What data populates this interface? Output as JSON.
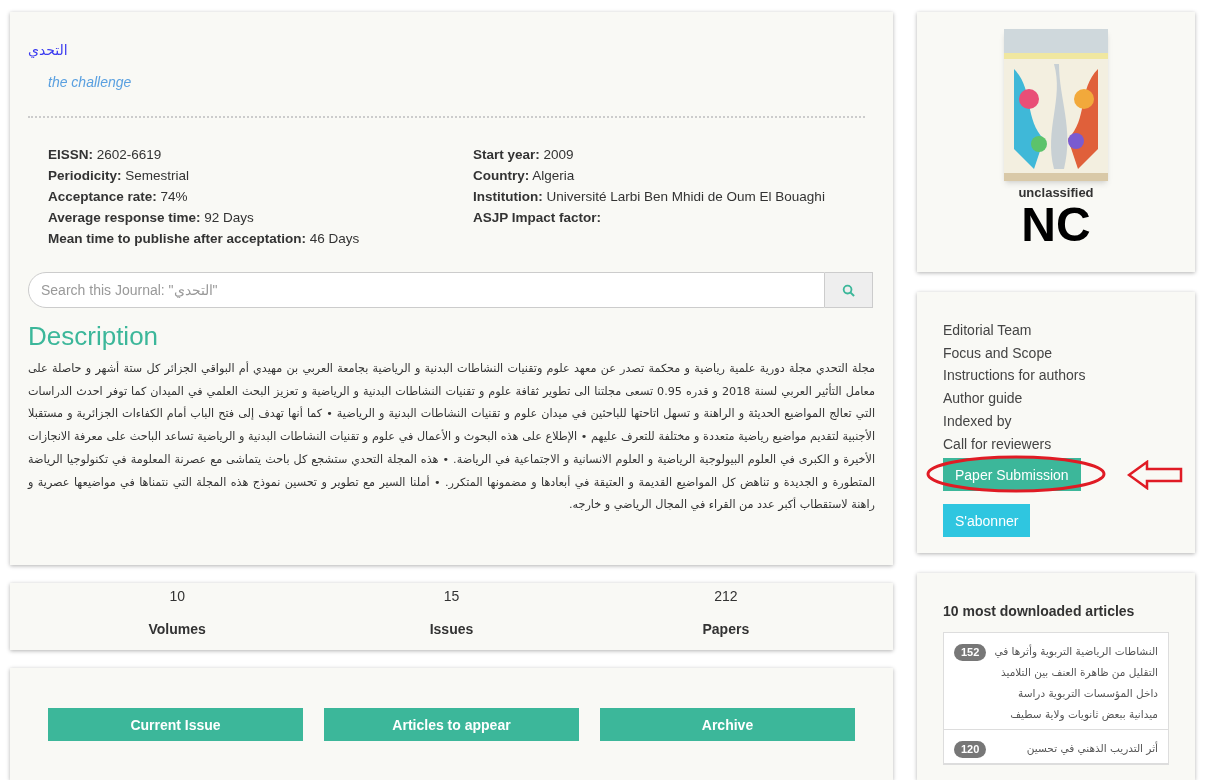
{
  "journal": {
    "title_ar": "التحدي",
    "title_en": "the challenge"
  },
  "info_left": [
    {
      "label": "EISSN:",
      "value": "2602-6619"
    },
    {
      "label": "Periodicity:",
      "value": "Semestrial"
    },
    {
      "label": "Acceptance rate:",
      "value": "74%"
    },
    {
      "label": "Average response time:",
      "value": "92 Days"
    },
    {
      "label": "Mean time to publishe after acceptation:",
      "value": "46 Days"
    }
  ],
  "info_right": [
    {
      "label": "Start year:",
      "value": "2009"
    },
    {
      "label": "Country:",
      "value": "Algeria"
    },
    {
      "label": "Institution:",
      "value": "Université Larbi Ben Mhidi de Oum El Bouaghi"
    },
    {
      "label": "ASJP Impact factor:"
    }
  ],
  "search": {
    "placeholder": "Search this Journal: \"التحدي\""
  },
  "description": {
    "heading": "Description",
    "text": "مجلة التحدي مجلة دورية علمية رياضية و محكمة تصدر عن معهد علوم وتقنيات النشاطات البدنية و الرياضية بجامعة العربي بن مهيدي أم البواقي الجزائر كل ستة أشهر و حاصلة على معامل التأثير العربي لسنة 2018 و قدره 0.95 تسعى مجلتنا الى تطوير ثقافة علوم و تقنيات النشاطات البدنية و الرياضية و تعزيز البحث العلمي في الميدان كما توفر احدث الدراسات التي تعالج المواضيع الحديثة و الراهنة و تسهل اتاحتها للباحثين في ميدان علوم و تقنيات النشاطات البدنية و الرياضية • كما أنها تهدف إلى فتح الباب أمام الكفاءات الجزائرية و مستقبلا الأجنبية لتقديم مواضيع رياضية متعددة و مختلفة للتعرف عليهم • الإطلاع على هذه البحوث و الأعمال في علوم و تقنيات النشاطات البدنية و الرياضية تساعد الباحث على معرفة الانجازات الأخيرة و الكبرى في العلوم البيولوجية الرياضية و العلوم الانسانية و الاجتماعية في الرياضة. • هذه المجلة التحدي ستشجع كل باحث يتماشى مع عصرنة المعلومة في تكنولوجيا الرياضة المتطورة و الجديدة و تناهض كل المواضيع القديمة و العتيقة في أبعادها و مضمونها المتكرر. • أملنا السير مع تطوير و تحسين نموذج هذه المجلة التي نتمناها في مواضيعها عصرية و راهنة لاستقطاب أكبر عدد من القراء في المجال الرياضي و خارجه."
  },
  "stats": [
    {
      "value": "10",
      "label": "Volumes"
    },
    {
      "value": "15",
      "label": "Issues"
    },
    {
      "value": "212",
      "label": "Papers"
    }
  ],
  "actions": [
    "Current Issue",
    "Articles to appear",
    "Archive"
  ],
  "classification": {
    "caption": "unclassified",
    "grade": "NC"
  },
  "links": [
    "Editorial Team",
    "Focus and Scope",
    "Instructions for authors",
    "Author guide",
    "Indexed by",
    "Call for reviewers"
  ],
  "buttons": [
    {
      "label": "Paper Submission",
      "highlighted": true
    },
    {
      "label": "S'abonner",
      "highlighted": false
    }
  ],
  "downloads": {
    "title": "10 most downloaded articles",
    "articles": [
      {
        "count": "152",
        "title": "النشاطات الرياضية التربوية وأثرها في التقليل من ظاهرة العنف بين التلاميذ داخل المؤسسات التربوية دراسة ميدانية ببعض ثانويات ولاية سطيف"
      },
      {
        "count": "120",
        "title": "أثر التدريب الذهني في تحسين"
      }
    ]
  }
}
